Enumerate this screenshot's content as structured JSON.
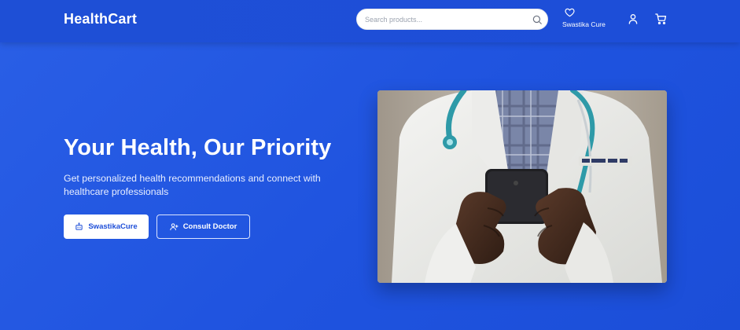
{
  "navbar": {
    "brand": "HealthCart",
    "search": {
      "placeholder": "Search products..."
    },
    "wishlist_label": "Swastika Cure",
    "icons": [
      "search-icon",
      "heart-icon",
      "user-icon",
      "cart-icon"
    ]
  },
  "hero": {
    "title": "Your Health, Our Priority",
    "subtitle": "Get personalized health recommendations and connect with healthcare professionals",
    "primary_button": "SwastikaCure",
    "secondary_button": "Consult Doctor",
    "primary_icon": "bot-icon",
    "secondary_icon": "user-plus-icon"
  },
  "colors": {
    "accent": "#1d4ed8",
    "navbar": "#1e4fd6",
    "text_light": "#ffffff"
  }
}
